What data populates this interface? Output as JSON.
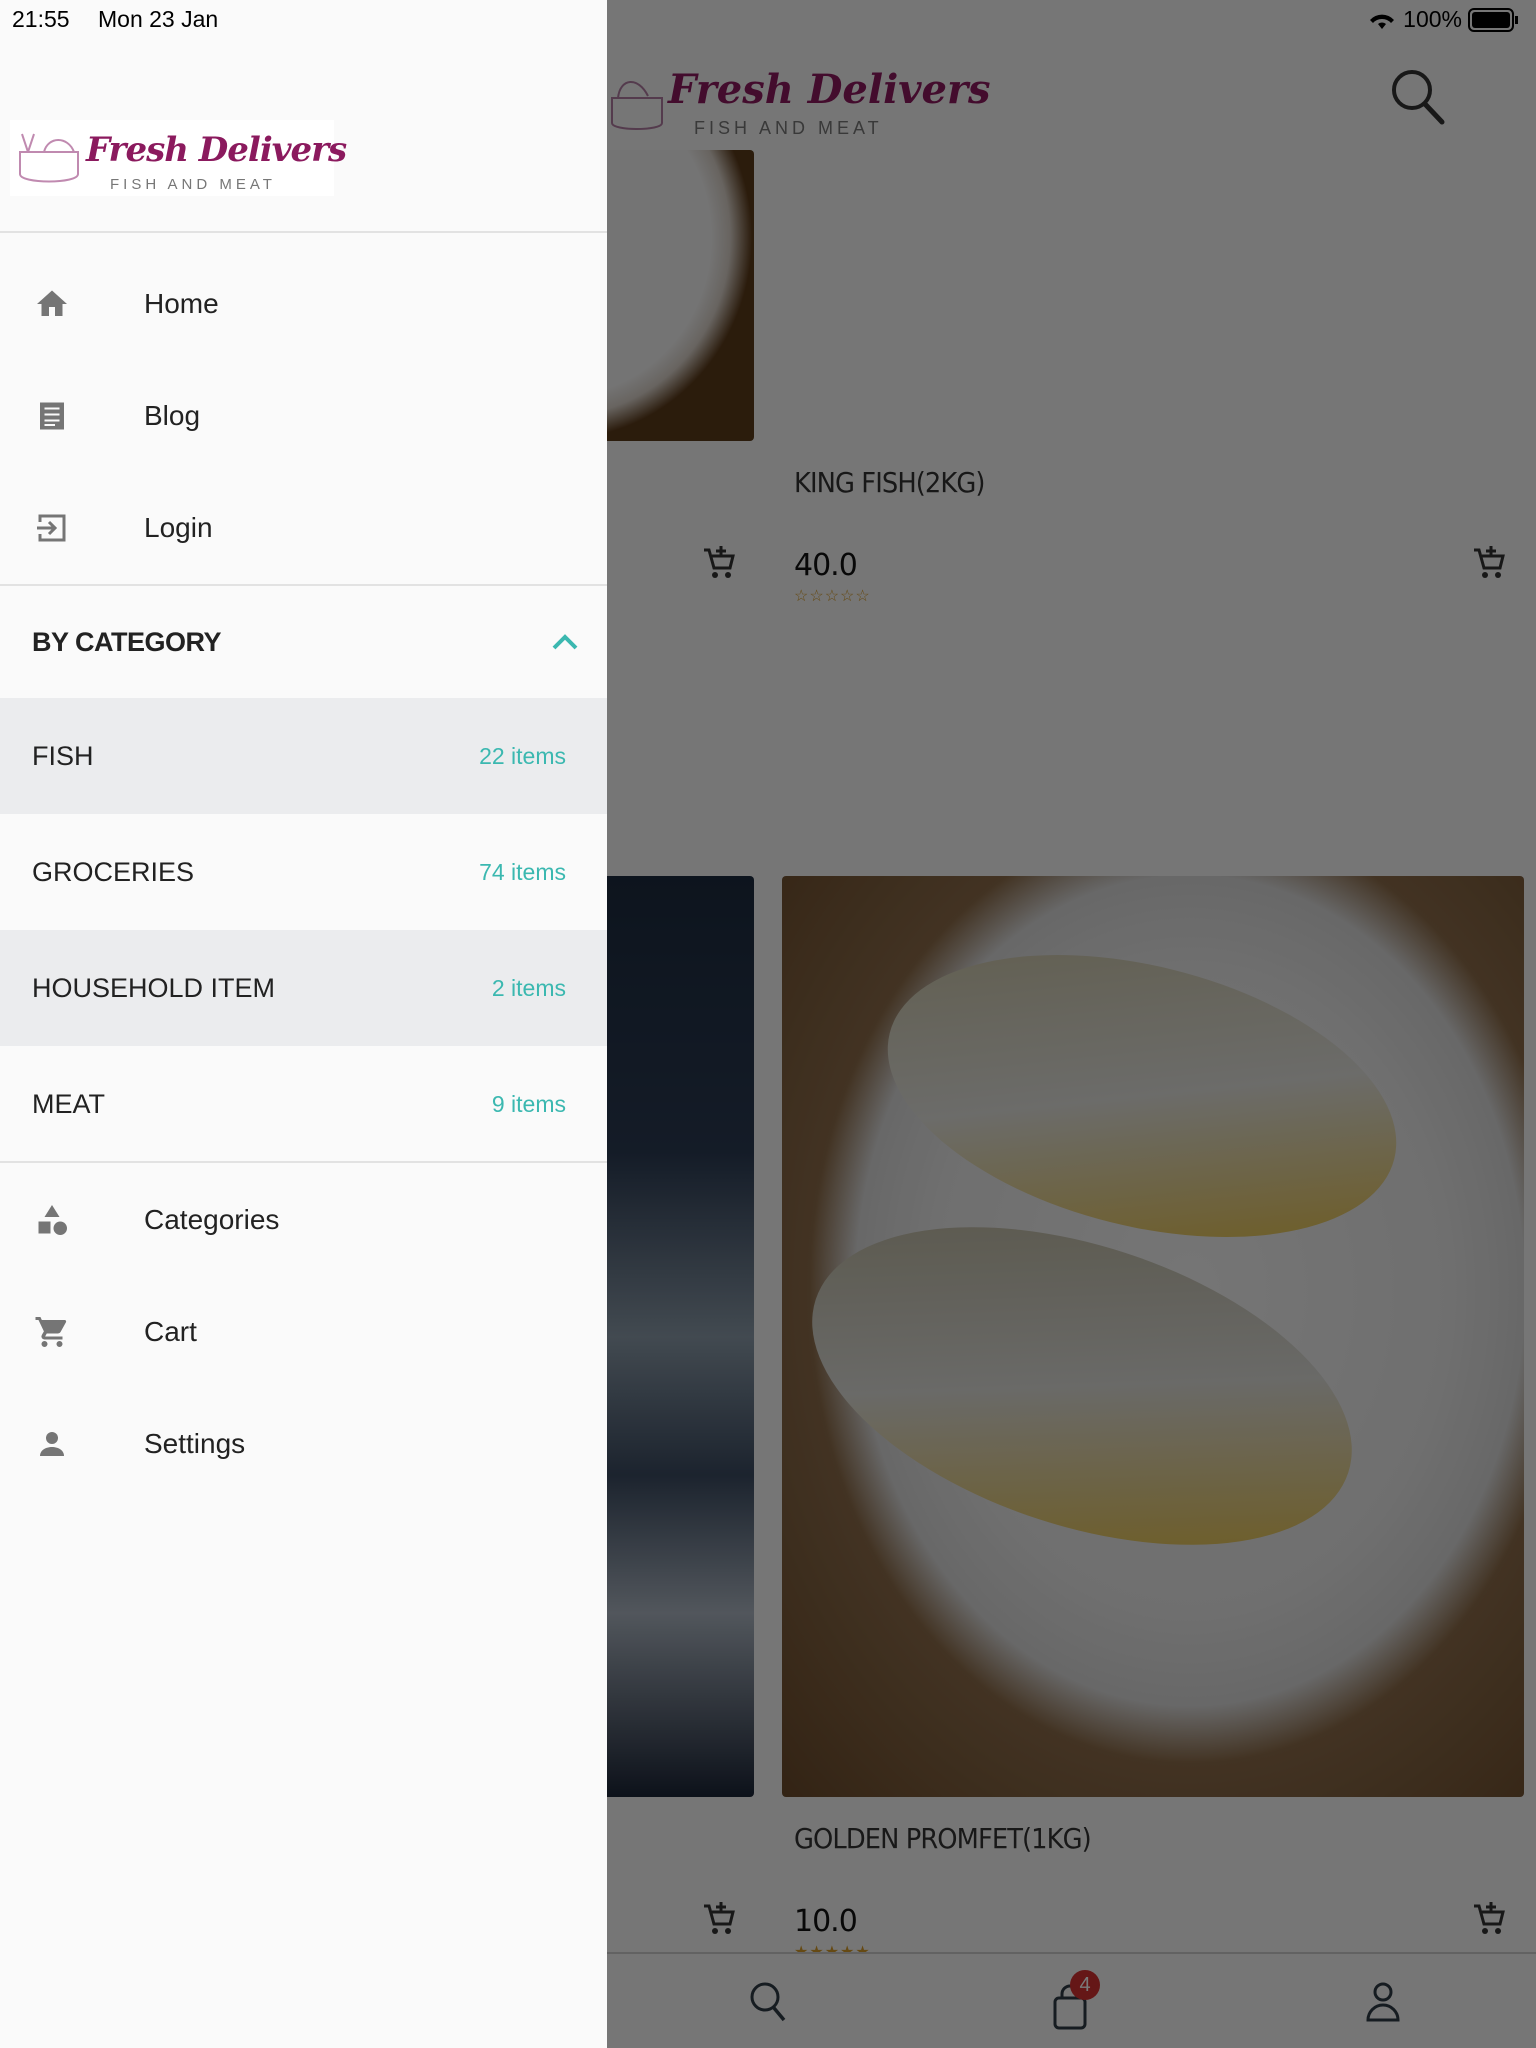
{
  "status_bar": {
    "time": "21:55",
    "date": "Mon 23 Jan",
    "battery": "100%"
  },
  "brand": {
    "name": "Fresh Delivers",
    "tagline": "FISH AND MEAT",
    "primary_color": "#8b1a5e"
  },
  "drawer": {
    "nav_items": [
      {
        "label": "Home",
        "icon": "home-icon"
      },
      {
        "label": "Blog",
        "icon": "blog-icon"
      },
      {
        "label": "Login",
        "icon": "login-icon"
      }
    ],
    "category_header": "BY CATEGORY",
    "categories": [
      {
        "name": "FISH",
        "count": "22 items",
        "highlighted": true
      },
      {
        "name": "GROCERIES",
        "count": "74 items",
        "highlighted": false
      },
      {
        "name": "HOUSEHOLD ITEM",
        "count": "2 items",
        "highlighted": true
      },
      {
        "name": "MEAT",
        "count": "9 items",
        "highlighted": false
      }
    ],
    "bottom_items": [
      {
        "label": "Categories",
        "icon": "categories-icon"
      },
      {
        "label": "Cart",
        "icon": "cart-icon"
      },
      {
        "label": "Settings",
        "icon": "person-icon"
      }
    ],
    "accent_color": "#3bb8b0"
  },
  "products": [
    {
      "title": "KING FISH(2KG)",
      "price": "40.0",
      "rating": 0
    },
    {
      "title": "GOLDEN PROMFET(1KG)",
      "price": "10.0",
      "rating": 0
    }
  ],
  "bottom_bar": {
    "cart_badge": "4"
  }
}
